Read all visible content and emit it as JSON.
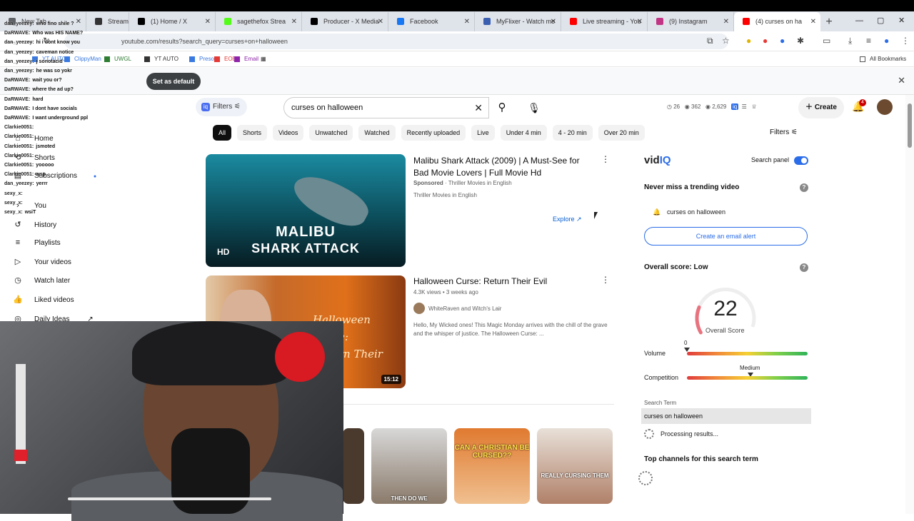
{
  "browser": {
    "tabs": [
      {
        "label": "New Tab",
        "icon_color": "#5f6368",
        "icon": "globe-icon"
      },
      {
        "label": "Stream",
        "icon_color": "#333333",
        "icon": "stream-icon"
      },
      {
        "label": "(1) Home / X",
        "icon_color": "#000000",
        "icon": "x-icon"
      },
      {
        "label": "sagethefox Strea",
        "icon_color": "#53fc18",
        "icon": "kick-icon"
      },
      {
        "label": "Producer - X Media",
        "icon_color": "#000000",
        "icon": "x-icon"
      },
      {
        "label": "Facebook",
        "icon_color": "#1877f2",
        "icon": "facebook-icon"
      },
      {
        "label": "MyFlixer - Watch mo",
        "icon_color": "#3a5fb0",
        "icon": "myflixer-icon"
      },
      {
        "label": "Live streaming - You",
        "icon_color": "#ff0000",
        "icon": "youtube-icon"
      },
      {
        "label": "(9) Instagram",
        "icon_color": "#c13584",
        "icon": "instagram-icon"
      },
      {
        "label": "(4) curses on ha",
        "icon_color": "#ff0000",
        "icon": "youtube-icon",
        "active": true
      }
    ],
    "url": "youtube.com/results?search_query=curses+on+halloween",
    "bookmarks": [
      {
        "label": "YT AUTO",
        "color": "#3a7ae0"
      },
      {
        "label": "ClippyMan",
        "color": "#3a7ae0"
      },
      {
        "label": "UWGL",
        "color": "#2e7d32"
      },
      {
        "label": "YT AUTO",
        "color": "#333333"
      },
      {
        "label": "Preso",
        "color": "#3a7ae0"
      },
      {
        "label": "EOB",
        "color": "#e53935"
      },
      {
        "label": "Email",
        "color": "#8e24aa"
      }
    ],
    "all_bookmarks": "All Bookmarks",
    "set_default": "Set as default"
  },
  "youtube": {
    "filters_label": "Filters",
    "search_value": "curses on halloween",
    "stats": {
      "a": "26",
      "b": "362",
      "c": "2,629"
    },
    "create_label": "Create",
    "notif_count": "4",
    "chips": [
      "All",
      "Shorts",
      "Videos",
      "Unwatched",
      "Watched",
      "Recently uploaded",
      "Live",
      "Under 4 min",
      "4 - 20 min",
      "Over 20 min"
    ],
    "filters_right": "Filters",
    "sidebar": {
      "items": [
        "Home",
        "Shorts",
        "Subscriptions",
        "You",
        "History",
        "Playlists",
        "Your videos",
        "Watch later",
        "Liked videos",
        "Daily Ideas"
      ]
    },
    "results": [
      {
        "title_line1": "Malibu Shark Attack (2009) | A Must-See for",
        "title_line2": "Bad Movie Lovers | Full Movie Hd",
        "sponsored": "Sponsored",
        "channel": "Thriller Movies in English",
        "channel2": "Thriller Movies in English",
        "explore": "Explore",
        "thumb_text_1": "MALIBU",
        "thumb_text_2": "SHARK ATTACK",
        "thumb_hd": "HD"
      },
      {
        "title": "Halloween Curse: Return Their Evil",
        "meta": "4.3K views • 3 weeks ago",
        "channel": "WhiteRaven and Witch's Lair",
        "desc_line1": "Hello, My Wicked ones! This Magic Monday arrives with the chill of the grave",
        "desc_line2": "and the whisper of justice. The Halloween Curse: ...",
        "thumb_text_1": "Halloween Curse:",
        "thumb_text_2": "Return Their Evil",
        "duration": "15:12"
      }
    ],
    "shorts_captions": [
      "THEN DO WE",
      "CAN A CHRISTIAN BE CURSED??",
      "REALLY CURSING THEM"
    ]
  },
  "vidiq": {
    "logo_a": "vid",
    "logo_b": "IQ",
    "search_panel": "Search panel",
    "trending_heading": "Never miss a trending video",
    "trending_term": "curses on halloween",
    "alert_button": "Create an email alert",
    "overall_heading": "Overall score: Low",
    "score": "22",
    "score_label": "Overall Score",
    "volume_label": "Volume",
    "volume_value": "0",
    "competition_label": "Competition",
    "competition_value": "Medium",
    "search_term_label": "Search Term",
    "search_term": "curses on halloween",
    "processing": "Processing results...",
    "top_channels": "Top channels for this search term"
  },
  "chat": [
    {
      "user": "dan_yeezey:",
      "msg": "who fino shile ?"
    },
    {
      "user": "DaRWAVE:",
      "msg": "Who was HIS NAME?"
    },
    {
      "user": "dan_yeezey:",
      "msg": "hi i dont know you"
    },
    {
      "user": "dan_yeezey:",
      "msg": "caveman notice"
    },
    {
      "user": "dan_yeezey:",
      "msg": "j sonotacid"
    },
    {
      "user": "dan_yeezey:",
      "msg": "he was so yokr"
    },
    {
      "user": "DaRWAVE:",
      "msg": "wait you or?"
    },
    {
      "user": "DaRWAVE:",
      "msg": "where the ad up?"
    },
    {
      "user": "DaRWAVE:",
      "msg": "hard"
    },
    {
      "user": "DaRWAVE:",
      "msg": "I dont have socials"
    },
    {
      "user": "DaRWAVE:",
      "msg": "I want underground ppl"
    },
    {
      "user": "Clarkie0051:",
      "msg": ""
    },
    {
      "user": "Clarkie0051:",
      "msg": ""
    },
    {
      "user": "Clarkie0051:",
      "msg": "jsmoted"
    },
    {
      "user": "Clarkie0051:",
      "msg": ""
    },
    {
      "user": "Clarkie0051:",
      "msg": "yooooo"
    },
    {
      "user": "Clarkie0051:",
      "msg": "wsp"
    },
    {
      "user": "dan_yeezey:",
      "msg": "yerrr"
    },
    {
      "user": "sexy_x:",
      "msg": ""
    },
    {
      "user": "sexy_x:",
      "msg": ""
    },
    {
      "user": "sexy_x:",
      "msg": "wsiT"
    }
  ]
}
